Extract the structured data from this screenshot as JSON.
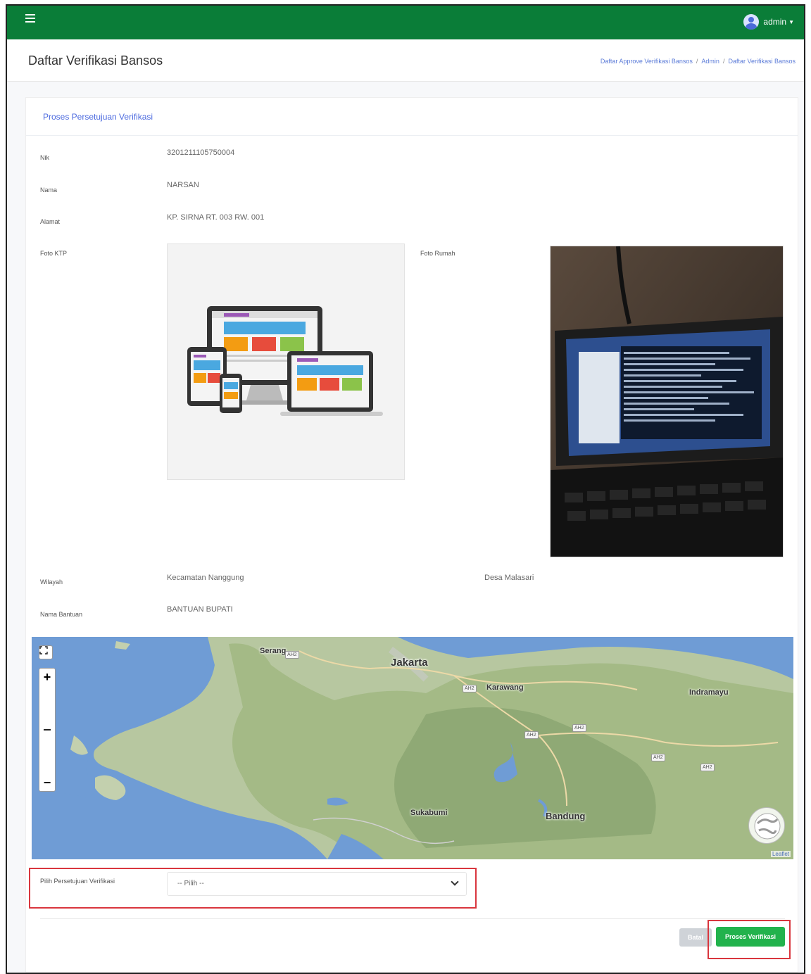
{
  "topbar": {
    "user_name": "admin",
    "menu_icon": "hamburger-icon",
    "avatar_icon": "user-avatar-icon",
    "color": "#0a7d38"
  },
  "header": {
    "title": "Daftar Verifikasi Bansos",
    "breadcrumb": [
      "Daftar Approve Verifikasi Bansos",
      "Admin",
      "Daftar Verifikasi Bansos"
    ],
    "breadcrumb_sep": "/"
  },
  "card": {
    "title": "Proses Persetujuan Verifikasi",
    "fields": {
      "nik_label": "Nik",
      "nik_value": "3201211105750004",
      "nama_label": "Nama",
      "nama_value": "NARSAN",
      "alamat_label": "Alamat",
      "alamat_value": "KP. SIRNA RT. 003 RW. 001",
      "foto_ktp_label": "Foto KTP",
      "foto_rumah_label": "Foto Rumah",
      "wilayah_label": "Wilayah",
      "kecamatan_value": "Kecamatan Nanggung",
      "desa_value": "Desa Malasari",
      "nama_bantuan_label": "Nama Bantuan",
      "nama_bantuan_value": "BANTUAN BUPATI"
    }
  },
  "map": {
    "places": [
      "Serang",
      "Jakarta",
      "Karawang",
      "Indramayu",
      "Sukabumi",
      "Bandung"
    ],
    "road_shield": "AH2",
    "zoom_in": "+",
    "zoom_out": "−",
    "attribution": "Leaflet"
  },
  "form": {
    "select_label": "Pilih Persetujuan Verifikasi",
    "select_value": "-- Pilih --"
  },
  "buttons": {
    "cancel": "Batal",
    "submit": "Proses Verifikasi"
  },
  "colors": {
    "accent": "#22b24c",
    "highlight": "#d9363e",
    "link": "#4d6bdf"
  }
}
